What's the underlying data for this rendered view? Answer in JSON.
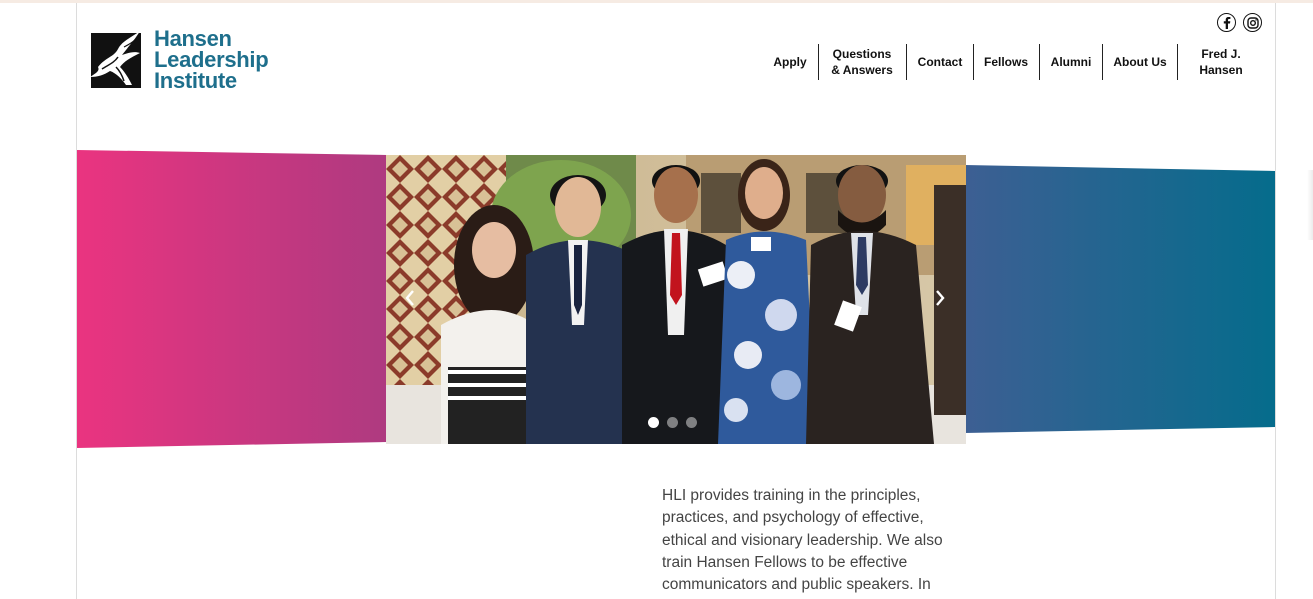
{
  "brand": {
    "logo_line1": "Hansen",
    "logo_line2": "Leadership",
    "logo_line3": "Institute",
    "color": "#1e6f8c"
  },
  "social": {
    "facebook_icon": "facebook-icon",
    "instagram_icon": "instagram-icon"
  },
  "nav": {
    "items": [
      {
        "label_l1": "Apply",
        "label_l2": ""
      },
      {
        "label_l1": "Questions",
        "label_l2": "& Answers"
      },
      {
        "label_l1": "Contact",
        "label_l2": ""
      },
      {
        "label_l1": "Fellows",
        "label_l2": ""
      },
      {
        "label_l1": "Alumni",
        "label_l2": ""
      },
      {
        "label_l1": "About Us",
        "label_l2": ""
      },
      {
        "label_l1": "Fred J.",
        "label_l2": "Hansen"
      }
    ]
  },
  "carousel": {
    "prev_icon": "chevron-left-icon",
    "next_icon": "chevron-right-icon",
    "slide_count": 3,
    "active_slide": 1,
    "left_band_colors": [
      "#ea3480",
      "#ae3a80"
    ],
    "right_band_colors": [
      "#3d5f93",
      "#056c8c"
    ]
  },
  "intro": {
    "text": "HLI provides training in the principles, practices, and psychology of effective, ethical and visionary leadership. We also train Hansen Fellows to be effective communicators and public speakers. In"
  }
}
